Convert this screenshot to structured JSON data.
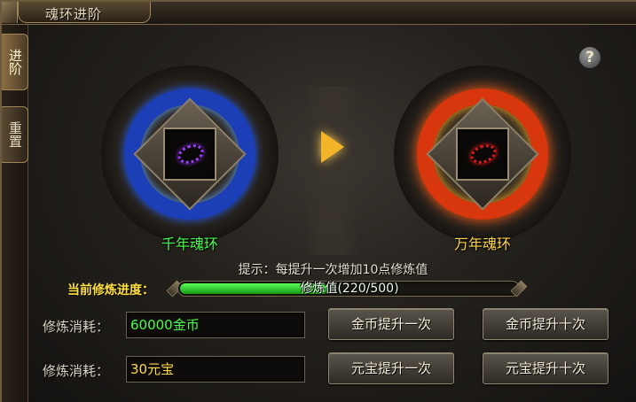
{
  "window": {
    "title": "魂环进阶"
  },
  "side_tabs": [
    {
      "label": "进阶",
      "active": true
    },
    {
      "label": "重置",
      "active": false
    }
  ],
  "help": {
    "icon": "question-mark-icon",
    "glyph": "?"
  },
  "source_ring": {
    "name": "千年魂环",
    "color": "#1c3fb8",
    "label_color": "#4cff4c",
    "icon": "purple-ring-icon"
  },
  "target_ring": {
    "name": "万年魂环",
    "color": "#d8360c",
    "label_color": "#ffd84a",
    "icon": "red-ring-icon"
  },
  "arrow": {
    "icon": "arrow-right-icon"
  },
  "tip": "提示：每提升一次增加10点修炼值",
  "progress": {
    "label": "当前修炼进度：",
    "text": "修炼值(220/500)",
    "current": 220,
    "max": 500
  },
  "costs": [
    {
      "label": "修炼消耗：",
      "value": "60000金币"
    },
    {
      "label": "修炼消耗：",
      "value": "30元宝"
    }
  ],
  "buttons": {
    "gold_once": "金币提升一次",
    "gold_ten": "金币提升十次",
    "yuanbao_once": "元宝提升一次",
    "yuanbao_ten": "元宝提升十次"
  }
}
